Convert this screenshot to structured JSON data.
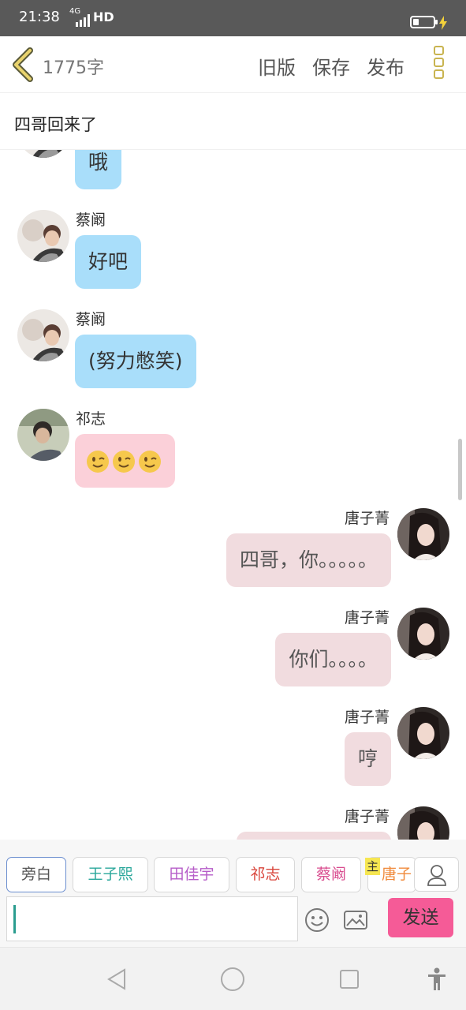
{
  "status": {
    "time": "21:38",
    "network": "4G",
    "hd": "HD",
    "battery_level": 0.3
  },
  "header": {
    "word_count": "1775字",
    "old_version": "旧版",
    "save": "保存",
    "publish": "发布"
  },
  "title": "四哥回来了",
  "messages": [
    {
      "side": "left",
      "speaker": "",
      "text": "哦",
      "color": "#a9defa",
      "avatar": "caikun"
    },
    {
      "side": "left",
      "speaker": "蔡阚",
      "text": "好吧",
      "color": "#a9defa",
      "avatar": "caikun"
    },
    {
      "side": "left",
      "speaker": "蔡阚",
      "text": "(努力憋笑)",
      "color": "#a9defa",
      "avatar": "caikun"
    },
    {
      "side": "left",
      "speaker": "祁志",
      "emoji": [
        "winking-face",
        "winking-face",
        "winking-face"
      ],
      "color": "#fbd0d9",
      "avatar": "qizhi"
    },
    {
      "side": "right",
      "speaker": "唐子菁",
      "text": "四哥，你。。。。。",
      "color": "#f1dcdf",
      "avatar": "tangzijing"
    },
    {
      "side": "right",
      "speaker": "唐子菁",
      "text": "你们。。。。",
      "color": "#f1dcdf",
      "avatar": "tangzijing"
    },
    {
      "side": "right",
      "speaker": "唐子菁",
      "text": "哼",
      "color": "#f1dcdf",
      "avatar": "tangzijing"
    },
    {
      "side": "right",
      "speaker": "唐子菁",
      "text": "",
      "color": "#f1dcdf",
      "avatar": "tangzijing"
    }
  ],
  "characters": [
    {
      "label": "旁白",
      "color": "#555555",
      "selected": true
    },
    {
      "label": "王子熙",
      "color": "#2aa79b"
    },
    {
      "label": "田佳宇",
      "color": "#b65cc8"
    },
    {
      "label": "祁志",
      "color": "#d9453b"
    },
    {
      "label": "蔡阚",
      "color": "#d94d8f"
    },
    {
      "label": "唐子",
      "color": "#f08a3b",
      "badge": "主"
    }
  ],
  "input": {
    "value": ""
  },
  "send_label": "发送",
  "colors": {
    "accent": "#f55b97",
    "menu_icon": "#c9b450"
  }
}
